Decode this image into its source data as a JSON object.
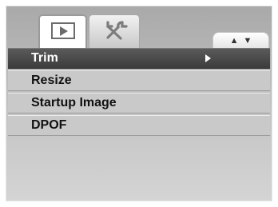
{
  "tabs": [
    {
      "icon": "playback-icon",
      "active": true
    },
    {
      "icon": "setup-tools-icon",
      "active": false
    }
  ],
  "scroll_indicator": {
    "up": "▲",
    "down": "▼"
  },
  "menu": {
    "items": [
      {
        "label": "Trim",
        "selected": true,
        "has_submenu": true
      },
      {
        "label": "Resize",
        "selected": false
      },
      {
        "label": "Startup Image",
        "selected": false
      },
      {
        "label": "DPOF",
        "selected": false
      }
    ]
  },
  "colors": {
    "selected_row": "#4a4a4a",
    "row": "#c9c9c9",
    "background": "#bdbdbd"
  }
}
